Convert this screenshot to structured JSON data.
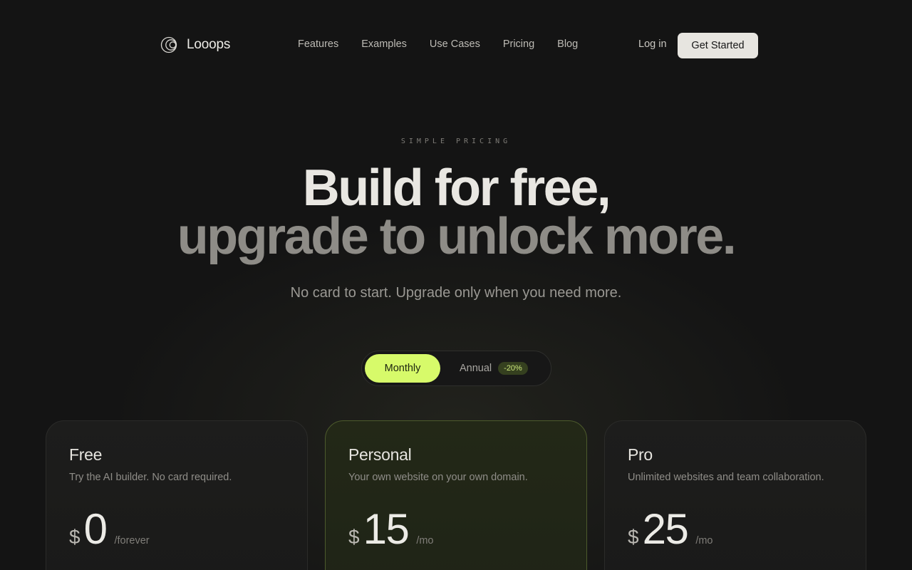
{
  "brand": {
    "name": "Looops"
  },
  "nav": {
    "links": [
      "Features",
      "Examples",
      "Use Cases",
      "Pricing",
      "Blog"
    ],
    "login": "Log in",
    "cta": "Get Started"
  },
  "hero": {
    "eyebrow": "SIMPLE PRICING",
    "title_line1": "Build for free,",
    "title_line2": "upgrade to unlock more.",
    "subtitle": "No card to start. Upgrade only when you need more."
  },
  "billing_toggle": {
    "monthly": "Monthly",
    "annual": "Annual",
    "annual_discount": "-20%",
    "selected": "Monthly"
  },
  "plans": [
    {
      "name": "Free",
      "description": "Try the AI builder. No card required.",
      "currency": "$",
      "price": "0",
      "period": "/forever"
    },
    {
      "name": "Personal",
      "description": "Your own website on your own domain.",
      "currency": "$",
      "price": "15",
      "period": "/mo"
    },
    {
      "name": "Pro",
      "description": "Unlimited websites and team collaboration.",
      "currency": "$",
      "price": "25",
      "period": "/mo"
    }
  ],
  "colors": {
    "background": "#141414",
    "accent": "#d7fa6a",
    "cta_bg": "#e7e5e0"
  }
}
